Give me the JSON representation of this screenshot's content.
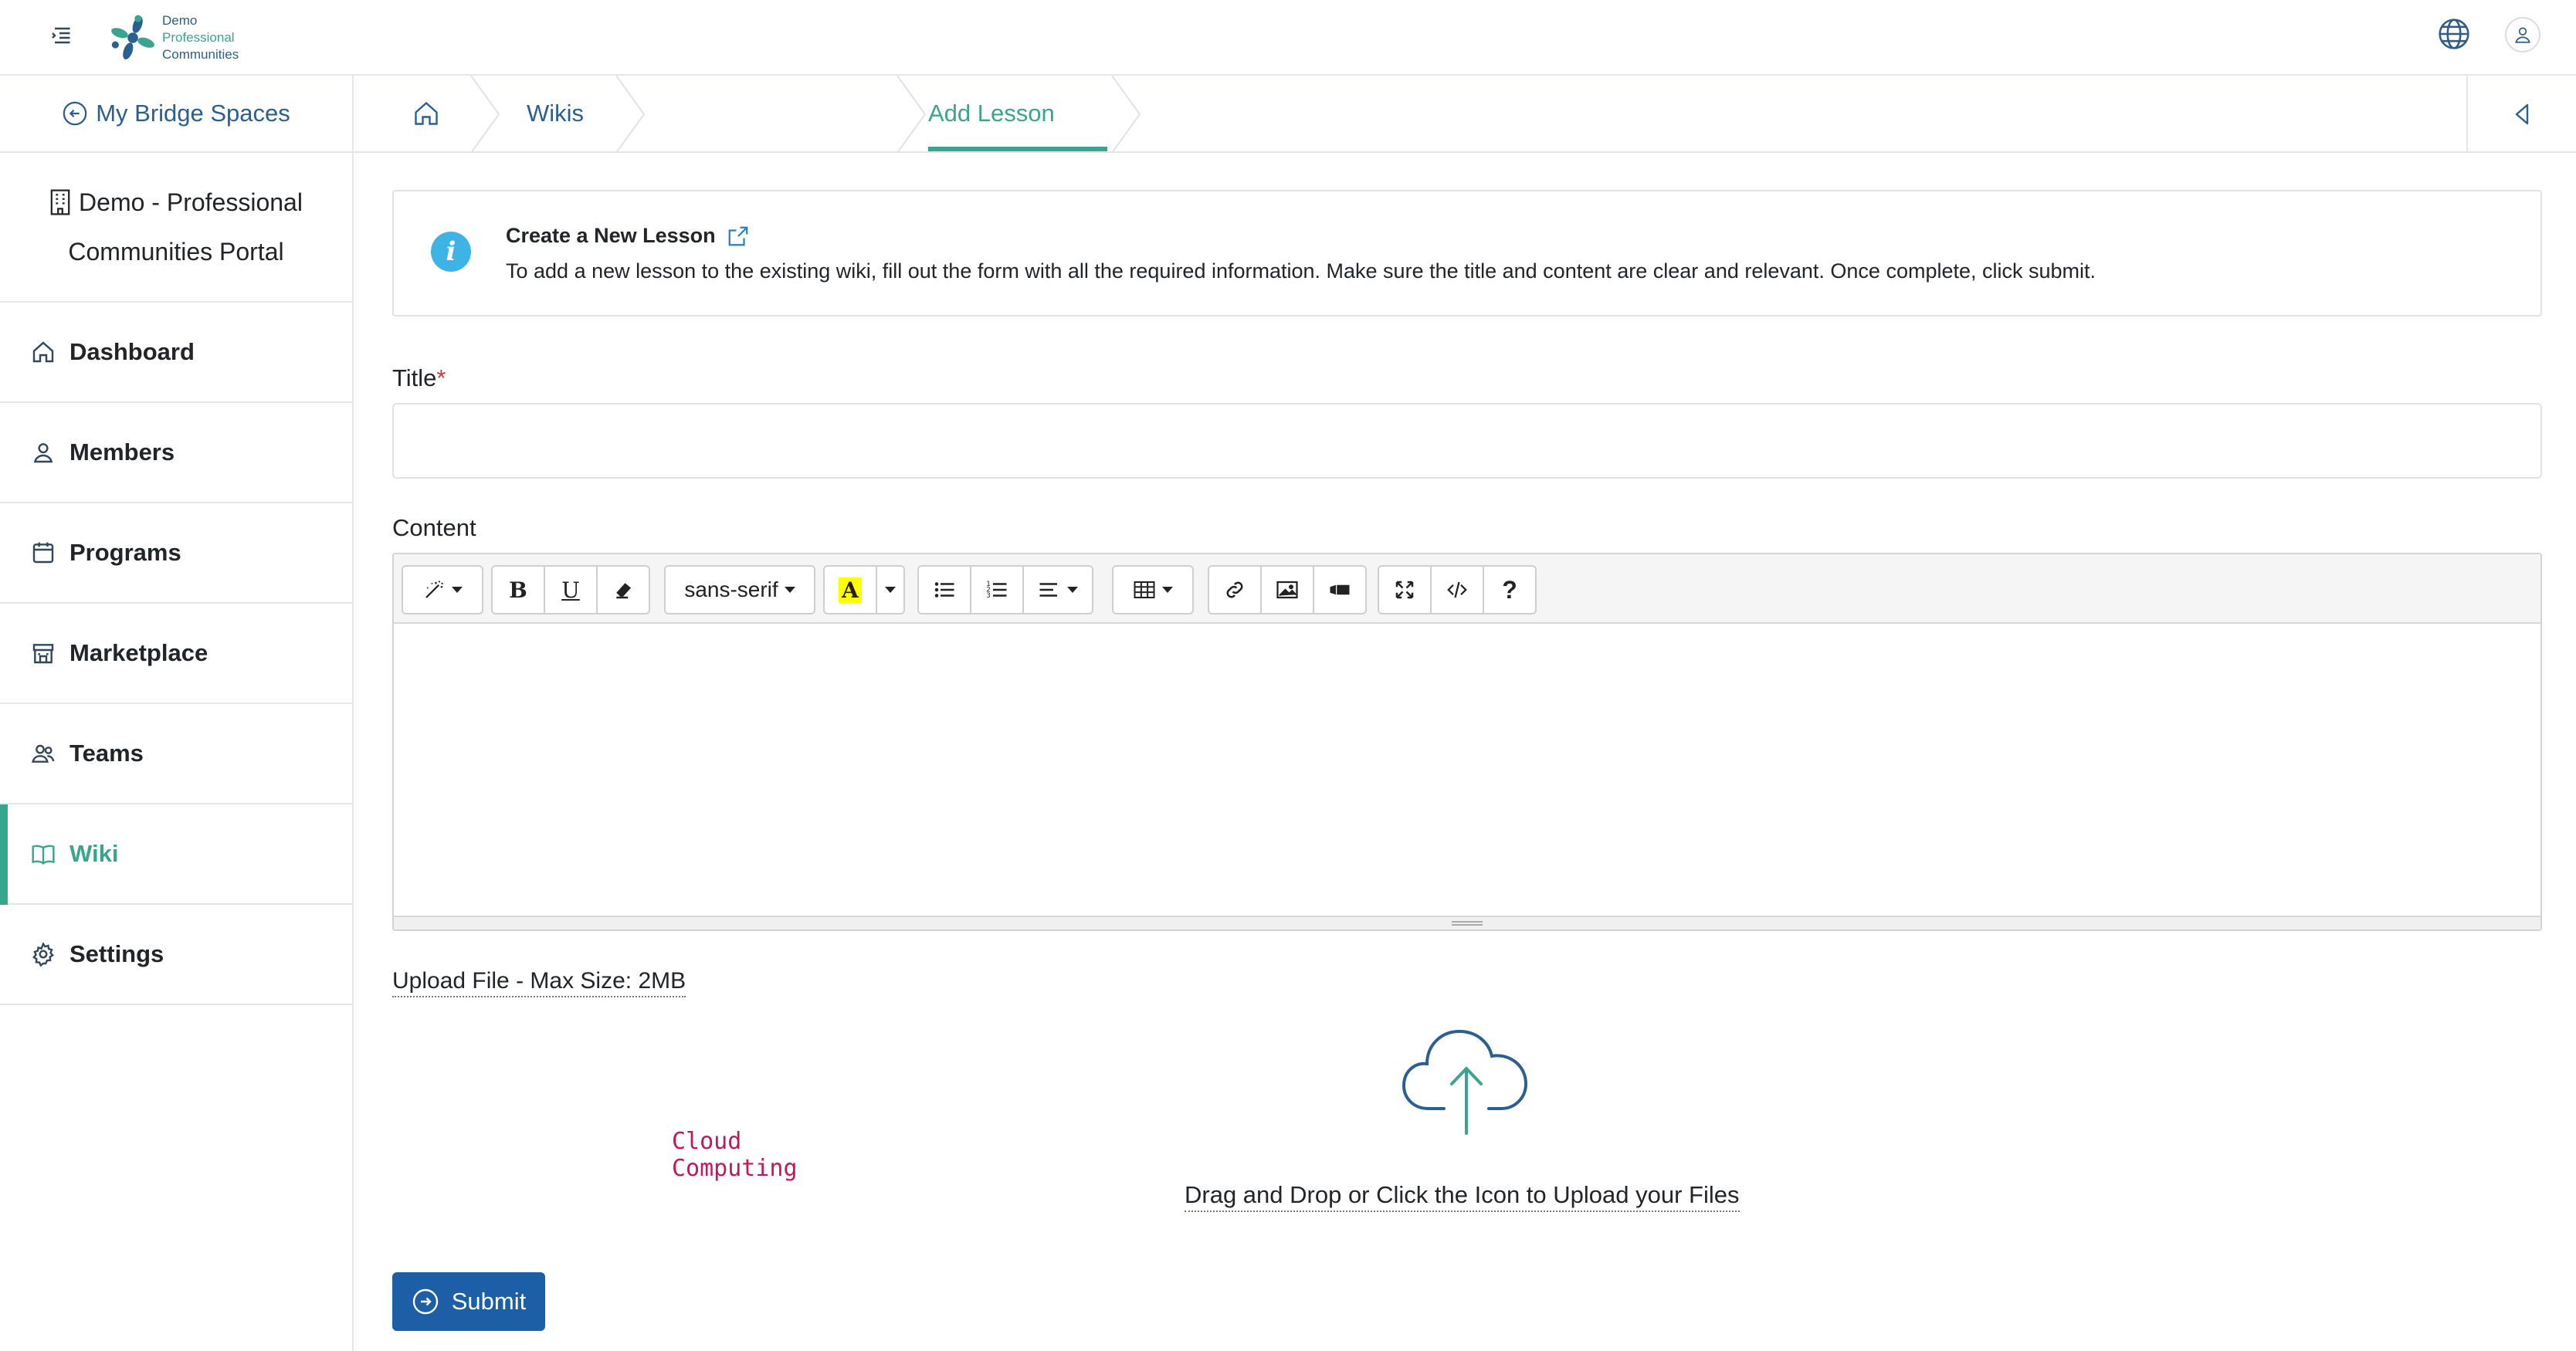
{
  "app": {
    "logo_lines": [
      "Demo",
      "Professional",
      "Communities"
    ]
  },
  "nav": {
    "back_label": "My Bridge Spaces",
    "portal_line1": "Demo - Professional",
    "portal_line2": "Communities Portal",
    "items": [
      {
        "label": "Dashboard",
        "icon": "home-icon"
      },
      {
        "label": "Members",
        "icon": "user-icon"
      },
      {
        "label": "Programs",
        "icon": "calendar-icon"
      },
      {
        "label": "Marketplace",
        "icon": "store-icon"
      },
      {
        "label": "Teams",
        "icon": "users-icon"
      },
      {
        "label": "Wiki",
        "icon": "book-icon",
        "active": true
      },
      {
        "label": "Settings",
        "icon": "gear-icon"
      }
    ]
  },
  "breadcrumb": {
    "items": [
      "Wikis",
      "Cloud Computing",
      "Add Lesson"
    ]
  },
  "info": {
    "title": "Create a New Lesson",
    "text": "To add a new lesson to the existing wiki, fill out the form with all the required information. Make sure the title and content are clear and relevant. Once complete, click submit."
  },
  "form": {
    "title_label": "Title",
    "required_mark": "*",
    "title_value": "",
    "content_label": "Content",
    "font_select": "sans-serif",
    "upload_label": "Upload File - Max Size: 2MB",
    "drop_text": "Drag and Drop or Click the Icon to Upload your Files",
    "submit_label": "Submit"
  },
  "colors": {
    "accent": "#3aa58e",
    "primary": "#1d5fa6",
    "link": "#2a5f94",
    "code_crumb": "#c2185b",
    "info": "#3eb4e6"
  }
}
